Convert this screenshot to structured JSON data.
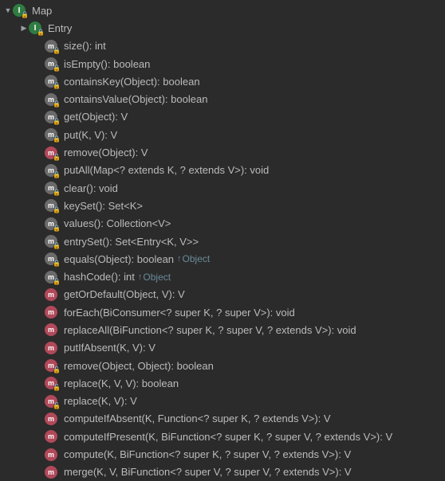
{
  "root": {
    "name": "Map",
    "expanded": true
  },
  "children": [
    {
      "kind": "interface",
      "icon": "interface",
      "badge": "lock",
      "label": "Entry",
      "hasChildren": true,
      "expanded": false
    },
    {
      "kind": "method",
      "icon": "method-gray",
      "badge": "lock",
      "label": "size(): int"
    },
    {
      "kind": "method",
      "icon": "method-gray",
      "badge": "lock",
      "label": "isEmpty(): boolean"
    },
    {
      "kind": "method",
      "icon": "method-gray",
      "badge": "lock",
      "label": "containsKey(Object): boolean"
    },
    {
      "kind": "method",
      "icon": "method-gray",
      "badge": "lock",
      "label": "containsValue(Object): boolean"
    },
    {
      "kind": "method",
      "icon": "method-gray",
      "badge": "lock",
      "label": "get(Object): V"
    },
    {
      "kind": "method",
      "icon": "method-gray",
      "badge": "lock",
      "label": "put(K, V): V"
    },
    {
      "kind": "method",
      "icon": "method-pub",
      "badge": "unlock",
      "label": "remove(Object): V"
    },
    {
      "kind": "method",
      "icon": "method-gray",
      "badge": "lock",
      "label": "putAll(Map<? extends K, ? extends V>): void"
    },
    {
      "kind": "method",
      "icon": "method-gray",
      "badge": "lock",
      "label": "clear(): void"
    },
    {
      "kind": "method",
      "icon": "method-gray",
      "badge": "lock",
      "label": "keySet(): Set<K>"
    },
    {
      "kind": "method",
      "icon": "method-gray",
      "badge": "lock",
      "label": "values(): Collection<V>"
    },
    {
      "kind": "method",
      "icon": "method-gray",
      "badge": "lock",
      "label": "entrySet(): Set<Entry<K, V>>"
    },
    {
      "kind": "method",
      "icon": "method-gray",
      "badge": "lock",
      "label": "equals(Object): boolean",
      "origin": "Object"
    },
    {
      "kind": "method",
      "icon": "method-gray",
      "badge": "lock",
      "label": "hashCode(): int",
      "origin": "Object"
    },
    {
      "kind": "method",
      "icon": "method-pub",
      "badge": null,
      "label": "getOrDefault(Object, V): V"
    },
    {
      "kind": "method",
      "icon": "method-pub",
      "badge": null,
      "label": "forEach(BiConsumer<? super K, ? super V>): void"
    },
    {
      "kind": "method",
      "icon": "method-pub",
      "badge": null,
      "label": "replaceAll(BiFunction<? super K, ? super V, ? extends V>): void"
    },
    {
      "kind": "method",
      "icon": "method-pub",
      "badge": null,
      "label": "putIfAbsent(K, V): V"
    },
    {
      "kind": "method",
      "icon": "method-pub",
      "badge": "unlock",
      "label": "remove(Object, Object): boolean"
    },
    {
      "kind": "method",
      "icon": "method-pub",
      "badge": "unlock",
      "label": "replace(K, V, V): boolean"
    },
    {
      "kind": "method",
      "icon": "method-pub",
      "badge": "unlock",
      "label": "replace(K, V): V"
    },
    {
      "kind": "method",
      "icon": "method-pub",
      "badge": null,
      "label": "computeIfAbsent(K, Function<? super K, ? extends V>): V"
    },
    {
      "kind": "method",
      "icon": "method-pub",
      "badge": null,
      "label": "computeIfPresent(K, BiFunction<? super K, ? super V, ? extends V>): V"
    },
    {
      "kind": "method",
      "icon": "method-pub",
      "badge": null,
      "label": "compute(K, BiFunction<? super K, ? super V, ? extends V>): V"
    },
    {
      "kind": "method",
      "icon": "method-pub",
      "badge": null,
      "label": "merge(K, V, BiFunction<? super V, ? super V, ? extends V>): V"
    }
  ],
  "glyphs": {
    "arrowDown": "▼",
    "arrowRight": "▶",
    "upArrow": "↑"
  }
}
